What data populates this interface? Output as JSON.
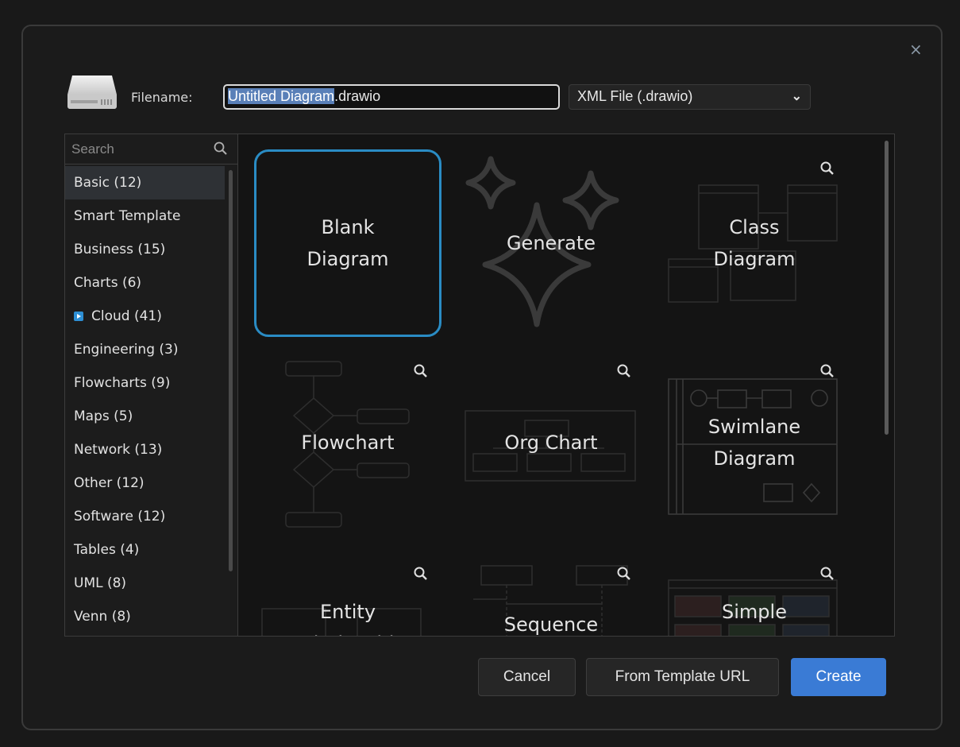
{
  "dialog": {
    "close_label": "×",
    "filename_label": "Filename:",
    "filename_selected": "Untitled Diagram",
    "filename_ext": ".drawio",
    "format_selected": "XML File (.drawio)",
    "format_icon": "chevron-down-icon"
  },
  "sidebar": {
    "search_placeholder": "Search",
    "categories": [
      {
        "label": "Basic (12)"
      },
      {
        "label": "Smart Template"
      },
      {
        "label": "Business (15)"
      },
      {
        "label": "Charts (6)"
      },
      {
        "label": "Cloud (41)"
      },
      {
        "label": "Engineering (3)"
      },
      {
        "label": "Flowcharts (9)"
      },
      {
        "label": "Maps (5)"
      },
      {
        "label": "Network (13)"
      },
      {
        "label": "Other (12)"
      },
      {
        "label": "Software (12)"
      },
      {
        "label": "Tables (4)"
      },
      {
        "label": "UML (8)"
      },
      {
        "label": "Venn (8)"
      }
    ]
  },
  "templates": [
    {
      "label": "Blank\nDiagram"
    },
    {
      "label": "Generate"
    },
    {
      "label": "Class\nDiagram"
    },
    {
      "label": "Flowchart"
    },
    {
      "label": "Org Chart"
    },
    {
      "label": "Swimlane\nDiagram"
    },
    {
      "label": "Entity\nRelationship"
    },
    {
      "label": "Sequence"
    },
    {
      "label": "Simple"
    }
  ],
  "buttons": {
    "cancel": "Cancel",
    "from_url": "From Template URL",
    "create": "Create"
  },
  "colors": {
    "accent": "#3a7bd5",
    "selection_border": "#2a8cc4",
    "cloud_icon": "#2d8fd5"
  }
}
